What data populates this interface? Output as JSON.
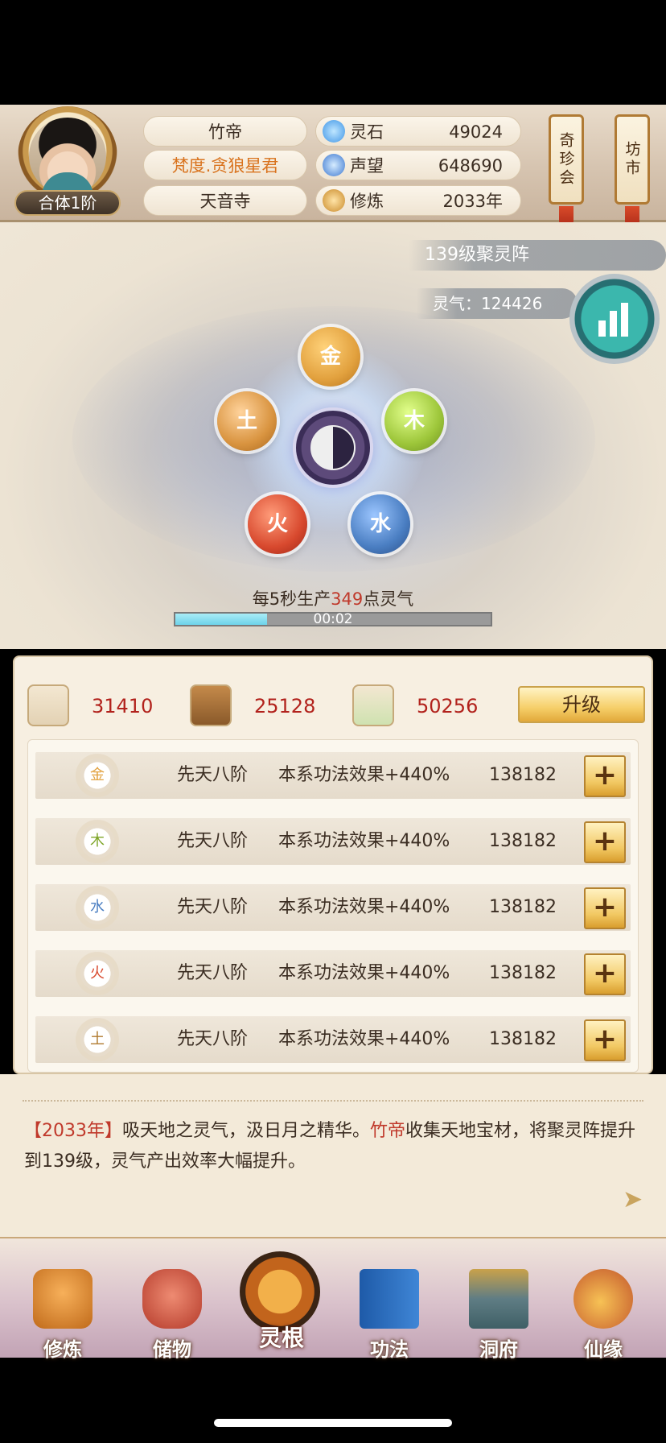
{
  "player": {
    "name": "竹帝",
    "title": "梵度.贪狼星君",
    "sect": "天音寺",
    "rank": "合体1阶"
  },
  "resources": [
    {
      "label": "灵石",
      "value": "49024",
      "icon": "spirit-stone-icon",
      "color": "#5fb3f0"
    },
    {
      "label": "声望",
      "value": "648690",
      "icon": "reputation-flame-icon",
      "color": "#4a8fe0"
    },
    {
      "label": "修炼",
      "value": "2033年",
      "icon": "meditation-icon",
      "color": "#d49b3e"
    }
  ],
  "scrolls": {
    "treasure": "奇珍会",
    "market": "坊市"
  },
  "array": {
    "level_label": "139级聚灵阵",
    "qi_label": "灵气：124426",
    "production_prefix": "每5秒生产",
    "production_value": "349",
    "production_suffix": "点灵气",
    "timer": "00:02",
    "progress": 0.29
  },
  "elements_orbs": [
    {
      "char": "金",
      "color": "#e2a13e"
    },
    {
      "char": "木",
      "color": "#9dc63a"
    },
    {
      "char": "水",
      "color": "#4a7ec2"
    },
    {
      "char": "火",
      "color": "#d8492e"
    },
    {
      "char": "土",
      "color": "#d99440"
    }
  ],
  "materials": [
    {
      "icon": "ore-icon",
      "value": "31410"
    },
    {
      "icon": "wood-icon",
      "value": "25128"
    },
    {
      "icon": "herb-icon",
      "value": "50256"
    }
  ],
  "upgrade_label": "升级",
  "rows": [
    {
      "element": "金",
      "color": "#e2a13e",
      "tier": "先天八阶",
      "effect": "本系功法效果+440%",
      "cost": "138182"
    },
    {
      "element": "木",
      "color": "#9dc63a",
      "tier": "先天八阶",
      "effect": "本系功法效果+440%",
      "cost": "138182"
    },
    {
      "element": "水",
      "color": "#4a7ec2",
      "tier": "先天八阶",
      "effect": "本系功法效果+440%",
      "cost": "138182"
    },
    {
      "element": "火",
      "color": "#d8492e",
      "tier": "先天八阶",
      "effect": "本系功法效果+440%",
      "cost": "138182"
    },
    {
      "element": "土",
      "color": "#c8954a",
      "tier": "先天八阶",
      "effect": "本系功法效果+440%",
      "cost": "138182"
    }
  ],
  "plus_label": "+",
  "log": {
    "year": "【2033年】",
    "text1": "吸天地之灵气，汲日月之精华。",
    "name": "竹帝",
    "text2": "收集天地宝材，将聚灵阵提升到139级，灵气产出效率大幅提升。"
  },
  "nav": [
    {
      "label": "修炼",
      "icon": "cultivate-icon"
    },
    {
      "label": "储物",
      "icon": "storage-bag-icon"
    },
    {
      "label": "灵根",
      "icon": "spirit-root-icon"
    },
    {
      "label": "功法",
      "icon": "manual-book-icon"
    },
    {
      "label": "洞府",
      "icon": "cave-house-icon"
    },
    {
      "label": "仙缘",
      "icon": "fate-gourd-icon"
    }
  ]
}
